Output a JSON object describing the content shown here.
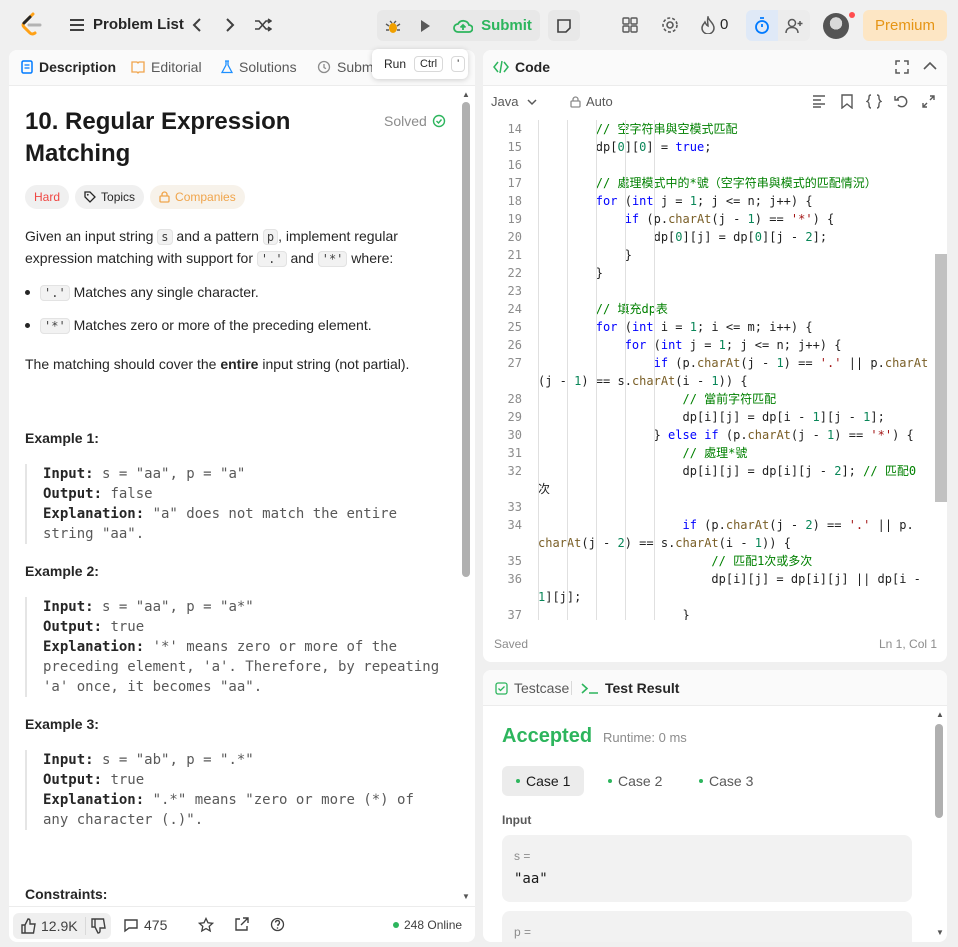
{
  "nav": {
    "problem_list": "Problem List",
    "submit": "Submit",
    "streak_count": "0",
    "premium": "Premium"
  },
  "tooltip": {
    "label": "Run",
    "key1": "Ctrl",
    "key2": "'"
  },
  "left_tabs": [
    {
      "label": "Description"
    },
    {
      "label": "Editorial"
    },
    {
      "label": "Solutions"
    },
    {
      "label": "Subm"
    }
  ],
  "problem": {
    "title": "10. Regular Expression Matching",
    "status": "Solved",
    "difficulty": "Hard",
    "topics": "Topics",
    "companies": "Companies",
    "intro_1": "Given an input string ",
    "var_s": "s",
    "intro_2": " and a pattern ",
    "var_p": "p",
    "intro_3": ", implement regular",
    "intro_4": "expression matching with support for ",
    "dot": "'.'",
    "and": " and ",
    "star": "'*'",
    "where": " where:",
    "bullets": [
      {
        "code": "'.'",
        "text": "Matches any single character."
      },
      {
        "code": "'*'",
        "text": "Matches zero or more of the preceding element."
      }
    ],
    "cover_1": "The matching should cover the ",
    "cover_bold": "entire",
    "cover_2": " input string (not partial).",
    "examples": [
      {
        "title": "Example 1:",
        "input": "s = \"aa\", p = \"a\"",
        "output": "false",
        "explanation_lines": [
          "\"a\" does not match the entire",
          "string \"aa\"."
        ]
      },
      {
        "title": "Example 2:",
        "input": "s = \"aa\", p = \"a*\"",
        "output": "true",
        "explanation_lines": [
          "'*' means zero or more of the",
          "preceding element, 'a'. Therefore, by repeating",
          "'a' once, it becomes \"aa\"."
        ]
      },
      {
        "title": "Example 3:",
        "input": "s = \"ab\", p = \".*\"",
        "output": "true",
        "explanation_lines": [
          "\".*\" means \"zero or more (*) of",
          "any character (.)\"."
        ]
      }
    ],
    "input_label": "Input: ",
    "output_label": "Output: ",
    "explanation_label": "Explanation: ",
    "constraints": "Constraints:"
  },
  "footer": {
    "likes": "12.9K",
    "comments": "475",
    "online": "248 Online"
  },
  "code_panel": {
    "title": "Code",
    "language": "Java",
    "auto": "Auto",
    "saved": "Saved",
    "cursor": "Ln 1, Col 1",
    "lines": [
      {
        "n": "14",
        "text": "        // 空字符串與空模式匹配"
      },
      {
        "n": "15",
        "text": "        dp[0][0] = true;"
      },
      {
        "n": "16",
        "text": ""
      },
      {
        "n": "17",
        "text": "        // 處理模式中的*號（空字符串與模式的匹配情況）"
      },
      {
        "n": "18",
        "text": "        for (int j = 1; j <= n; j++) {"
      },
      {
        "n": "19",
        "text": "            if (p.charAt(j - 1) == '*') {"
      },
      {
        "n": "20",
        "text": "                dp[0][j] = dp[0][j - 2];"
      },
      {
        "n": "21",
        "text": "            }"
      },
      {
        "n": "22",
        "text": "        }"
      },
      {
        "n": "23",
        "text": ""
      },
      {
        "n": "24",
        "text": "        // 填充dp表"
      },
      {
        "n": "25",
        "text": "        for (int i = 1; i <= m; i++) {"
      },
      {
        "n": "26",
        "text": "            for (int j = 1; j <= n; j++) {"
      },
      {
        "n": "27",
        "text": "                if (p.charAt(j - 1) == '.' || p.charAt"
      },
      {
        "n": "",
        "text": "(j - 1) == s.charAt(i - 1)) {"
      },
      {
        "n": "28",
        "text": "                    // 當前字符匹配"
      },
      {
        "n": "29",
        "text": "                    dp[i][j] = dp[i - 1][j - 1];"
      },
      {
        "n": "30",
        "text": "                } else if (p.charAt(j - 1) == '*') {"
      },
      {
        "n": "31",
        "text": "                    // 處理*號"
      },
      {
        "n": "32",
        "text": "                    dp[i][j] = dp[i][j - 2]; // 匹配0"
      },
      {
        "n": "",
        "text": "次"
      },
      {
        "n": "33",
        "text": ""
      },
      {
        "n": "34",
        "text": "                    if (p.charAt(j - 2) == '.' || p."
      },
      {
        "n": "",
        "text": "charAt(j - 2) == s.charAt(i - 1)) {"
      },
      {
        "n": "35",
        "text": "                        // 匹配1次或多次"
      },
      {
        "n": "36",
        "text": "                        dp[i][j] = dp[i][j] || dp[i -"
      },
      {
        "n": "",
        "text": "1][j];"
      },
      {
        "n": "37",
        "text": "                    }"
      }
    ]
  },
  "result_panel": {
    "tab_testcase": "Testcase",
    "tab_result": "Test Result",
    "verdict": "Accepted",
    "runtime": "Runtime: 0 ms",
    "cases": [
      "Case 1",
      "Case 2",
      "Case 3"
    ],
    "input_label": "Input",
    "vars": [
      {
        "name": "s =",
        "value": "\"aa\""
      },
      {
        "name": "p =",
        "value": ""
      }
    ]
  }
}
